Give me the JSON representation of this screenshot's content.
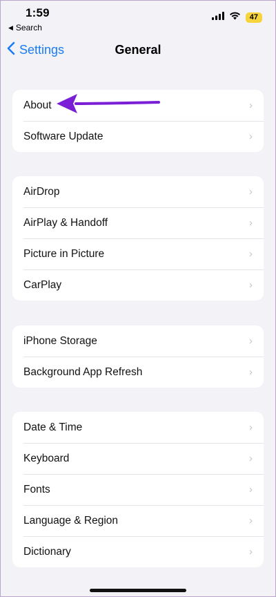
{
  "status_bar": {
    "time": "1:59",
    "back_app": "Search",
    "battery": "47",
    "battery_color": "#f7d43b"
  },
  "nav": {
    "back_label": "Settings",
    "title": "General",
    "accent_color": "#1a7cf5"
  },
  "groups": [
    {
      "items": [
        {
          "label": "About"
        },
        {
          "label": "Software Update"
        }
      ]
    },
    {
      "items": [
        {
          "label": "AirDrop"
        },
        {
          "label": "AirPlay & Handoff"
        },
        {
          "label": "Picture in Picture"
        },
        {
          "label": "CarPlay"
        }
      ]
    },
    {
      "items": [
        {
          "label": "iPhone Storage"
        },
        {
          "label": "Background App Refresh"
        }
      ]
    },
    {
      "items": [
        {
          "label": "Date & Time"
        },
        {
          "label": "Keyboard"
        },
        {
          "label": "Fonts"
        },
        {
          "label": "Language & Region"
        },
        {
          "label": "Dictionary"
        }
      ]
    }
  ],
  "annotation": {
    "arrow_color": "#7b1fd6",
    "icon": "purple-arrow-icon"
  },
  "icons": [
    "signal-icon",
    "wifi-icon",
    "battery-icon",
    "chevron-left-icon",
    "chevron-right-icon"
  ]
}
